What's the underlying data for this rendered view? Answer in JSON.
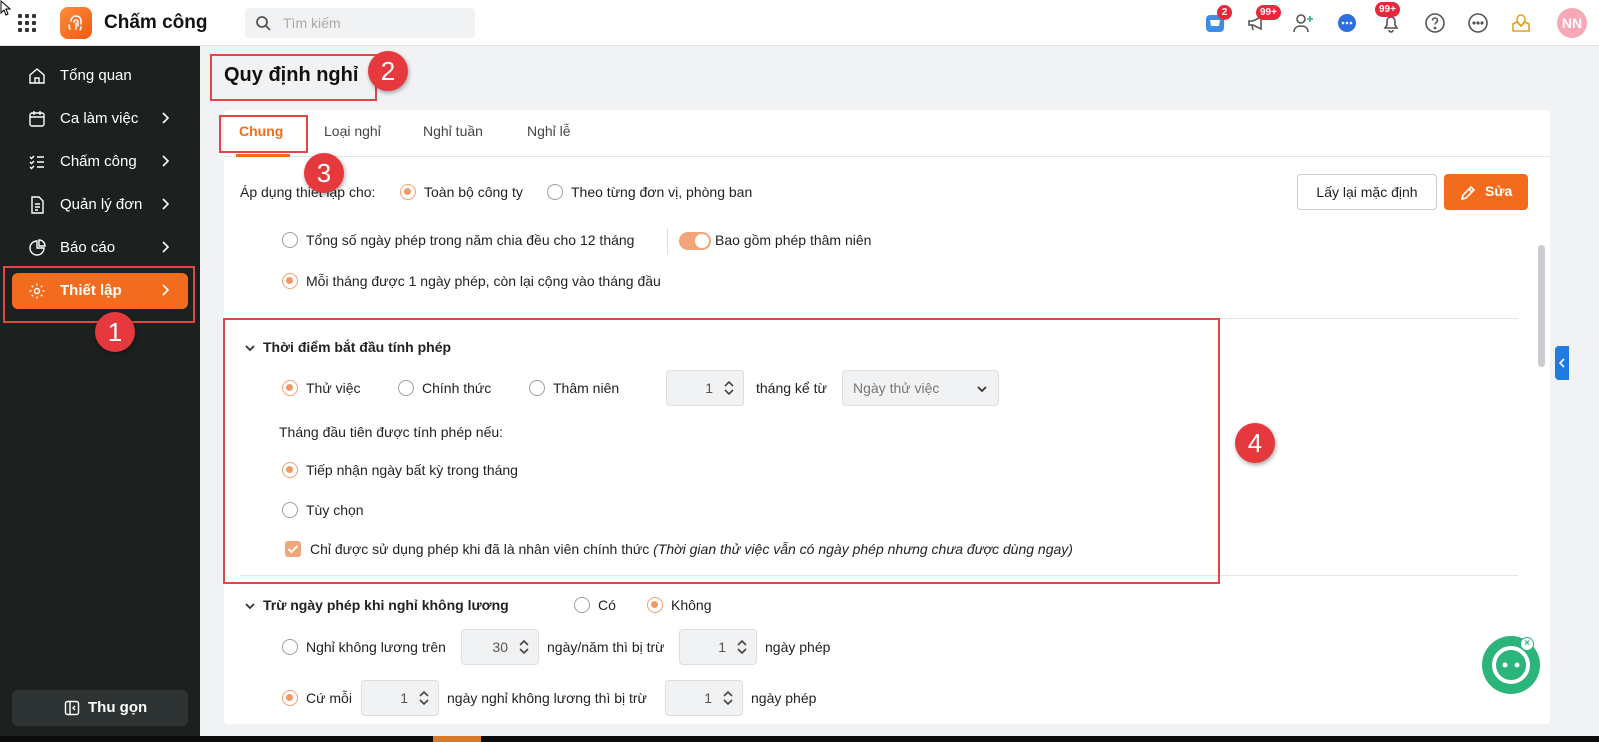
{
  "app": {
    "title": "Chấm công"
  },
  "search": {
    "placeholder": "Tìm kiếm"
  },
  "header": {
    "badges": {
      "cart": "2",
      "megaphone": "99+",
      "bell": "99+"
    },
    "avatar": "NN"
  },
  "sidebar": {
    "items": [
      {
        "label": "Tổng quan",
        "icon": "home-icon"
      },
      {
        "label": "Ca làm việc",
        "icon": "calendar-icon"
      },
      {
        "label": "Chấm công",
        "icon": "checklist-icon"
      },
      {
        "label": "Quản lý đơn",
        "icon": "document-icon"
      },
      {
        "label": "Báo cáo",
        "icon": "pie-chart-icon"
      },
      {
        "label": "Thiết lập",
        "icon": "gear-icon",
        "active": true
      }
    ],
    "collapse_label": "Thu gọn"
  },
  "page": {
    "title": "Quy định nghỉ"
  },
  "tabs": [
    "Chung",
    "Loại nghỉ",
    "Nghỉ tuần",
    "Nghỉ lễ"
  ],
  "annotations": [
    "1",
    "2",
    "3",
    "4"
  ],
  "apply": {
    "label": "Áp dụng thiết lập cho:",
    "options": [
      "Toàn bộ công ty",
      "Theo từng đơn vị, phòng ban"
    ],
    "selected": "Toàn bộ công ty"
  },
  "buttons": {
    "reset": "Lấy lại mặc định",
    "edit": "Sửa"
  },
  "accrual": {
    "option_split": "Tổng số ngày phép trong năm chia đều cho 12 tháng",
    "seniority_toggle_label": "Bao gồm phép thâm niên",
    "seniority_toggle_on": true,
    "option_monthly": "Mỗi tháng được 1 ngày phép, còn lại cộng vào tháng đầu",
    "selected": "option_monthly"
  },
  "start": {
    "title": "Thời điểm bắt đầu tính phép",
    "options": [
      "Thử việc",
      "Chính thức",
      "Thâm niên"
    ],
    "selected": "Thử việc",
    "months_value": "1",
    "months_label": "tháng kể từ",
    "from_select": "Ngày thử việc",
    "first_month_label": "Tháng đầu tiên được tính phép nếu:",
    "first_month_options": [
      "Tiếp nhận ngày bất kỳ trong tháng",
      "Tùy chọn"
    ],
    "first_month_selected": "Tiếp nhận ngày bất kỳ trong tháng",
    "official_only_checked": true,
    "official_only_label": "Chỉ được sử dụng phép khi đã là nhân viên chính thức",
    "official_only_note": "(Thời gian thử việc vẫn có ngày phép nhưng chưa được dùng ngay)"
  },
  "deduct": {
    "title": "Trừ ngày phép khi nghỉ không lương",
    "yes": "Có",
    "no": "Không",
    "selected": "Không",
    "rule1_prefix": "Nghỉ không lương trên",
    "rule1_value": "30",
    "rule1_mid": "ngày/năm thì bị trừ",
    "rule1_value2": "1",
    "rule1_suffix": "ngày phép",
    "rule2_prefix": "Cứ mỗi",
    "rule2_value": "1",
    "rule2_mid": "ngày nghỉ không lương thì bị trừ",
    "rule2_value2": "1",
    "rule2_suffix": "ngày phép",
    "selected_rule": "rule2"
  },
  "colors": {
    "accent": "#f36c1d",
    "sidebar_bg": "#1c2120",
    "annotation": "#e5393e"
  }
}
